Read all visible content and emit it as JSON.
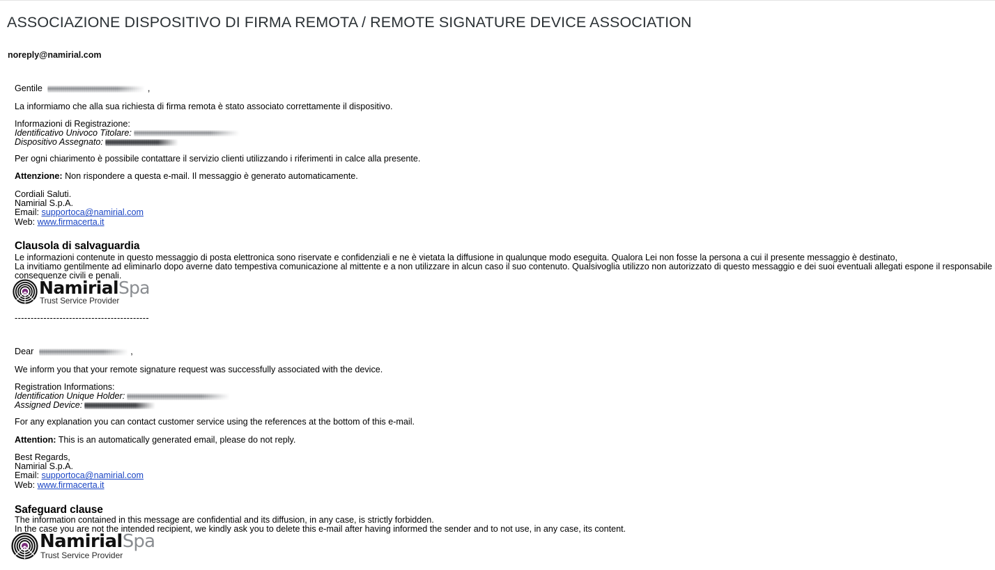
{
  "email": {
    "subject": "ASSOCIAZIONE DISPOSITIVO DI FIRMA REMOTA / REMOTE SIGNATURE DEVICE ASSOCIATION",
    "sender": "noreply@namirial.com"
  },
  "italian": {
    "greeting": "Gentile",
    "greeting_suffix": ",",
    "intro": "La informiamo che alla sua richiesta di firma remota è stato associato correttamente il dispositivo.",
    "reg_heading": "Informazioni di Registrazione:",
    "reg_label_holder": "Identificativo Univoco Titolare:",
    "reg_label_device": "Dispositivo Assegnato:",
    "contact": "Per ogni chiarimento è possibile contattare il servizio clienti utilizzando i riferimenti in calce alla presente.",
    "attention_label": "Attenzione:",
    "attention_text": "Non rispondere a questa e-mail. Il messaggio è generato automaticamente.",
    "sig_line1": "Cordiali Saluti.",
    "sig_line2": "Namirial S.p.A.",
    "email_label": "Email:",
    "email_value": "supportoca@namirial.com",
    "web_label": "Web:",
    "web_value": "www.firmacerta.it",
    "clause_title": "Clausola di salvaguardia",
    "clause_line1": "Le informazioni contenute in questo messaggio di posta elettronica sono riservate e confidenziali e ne è vietata la diffusione in qualunque modo eseguita. Qualora Lei non fosse la persona a cui il presente messaggio è destinato,",
    "clause_line2": "La invitiamo gentilmente ad eliminarlo dopo averne dato tempestiva comunicazione al mittente e a non utilizzare in alcun caso il suo contenuto. Qualsivoglia utilizzo non autorizzato di questo messaggio e dei suoi eventuali allegati espone il responsabile alle relative",
    "clause_line3": "consequenze civili e penali."
  },
  "separator": "------------------------------------------",
  "english": {
    "greeting": "Dear",
    "greeting_suffix": ",",
    "intro": "We inform you that your remote signature request was successfully associated with the device.",
    "reg_heading": "Registration Informations:",
    "reg_label_holder": "Identification Unique Holder:",
    "reg_label_device": "Assigned Device:",
    "contact": "For any explanation you can contact customer service using the references at the bottom of this e-mail.",
    "attention_label": "Attention:",
    "attention_text": "This is an automatically generated email, please do not reply.",
    "sig_line1": "Best Regards,",
    "sig_line2": "Namirial S.p.A.",
    "email_label": "Email:",
    "email_value": "supportoca@namirial.com",
    "web_label": "Web:",
    "web_value": "www.firmacerta.it",
    "clause_title": "Safeguard clause",
    "clause_line1": "The information contained in this message are confidential and its diffusion, in any case, is strictly forbidden.",
    "clause_line2": "In the case you are not the intended recipient, we kindly ask you to delete this e-mail after having informed the sender and to not use, in any case, its content."
  },
  "logo": {
    "name": "Namirial",
    "suffix": "Spa",
    "tagline": "Trust Service Provider",
    "mark_color": "#7b2d7b",
    "ring_color": "#111111"
  },
  "colors": {
    "link": "#1a45c4",
    "subject": "#2b3135",
    "text": "#000000"
  }
}
